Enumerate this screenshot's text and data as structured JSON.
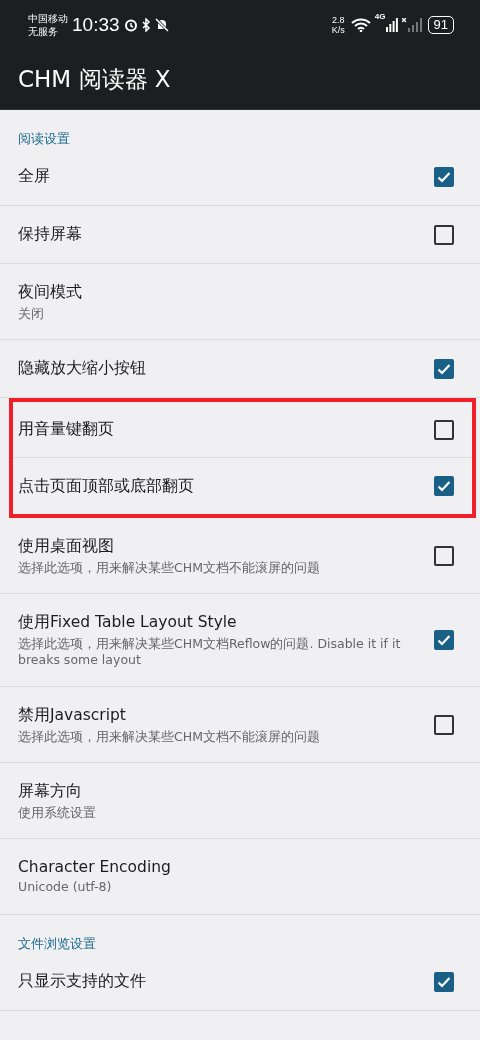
{
  "status_bar": {
    "carrier": "中国移动",
    "service": "无服务",
    "time": "10:33",
    "speed": "2.8",
    "speed_unit": "K/s",
    "network": "4G",
    "battery": "91"
  },
  "app_bar": {
    "title": "CHM 阅读器 X"
  },
  "sections": [
    {
      "title": "阅读设置",
      "items": [
        {
          "kind": "checkbox",
          "title": "全屏",
          "checked": true,
          "highlighted": false
        },
        {
          "kind": "checkbox",
          "title": "保持屏幕",
          "checked": false,
          "highlighted": false
        },
        {
          "kind": "text",
          "title": "夜间模式",
          "summary": "关闭",
          "highlighted": false
        },
        {
          "kind": "checkbox",
          "title": "隐藏放大缩小按钮",
          "checked": true,
          "highlighted": false
        },
        {
          "kind": "checkbox",
          "title": "用音量键翻页",
          "checked": false,
          "highlighted": true
        },
        {
          "kind": "checkbox",
          "title": "点击页面顶部或底部翻页",
          "checked": true,
          "highlighted": true
        },
        {
          "kind": "checkbox",
          "title": "使用桌面视图",
          "summary": "选择此选项，用来解决某些CHM文档不能滚屏的问题",
          "checked": false,
          "highlighted": false
        },
        {
          "kind": "checkbox",
          "title": "使用Fixed Table Layout Style",
          "summary": "选择此选项，用来解决某些CHM文档Reflow的问题. Disable it if it breaks some layout",
          "checked": true,
          "highlighted": false
        },
        {
          "kind": "checkbox",
          "title": "禁用Javascript",
          "summary": "选择此选项，用来解决某些CHM文档不能滚屏的问题",
          "checked": false,
          "highlighted": false
        },
        {
          "kind": "text",
          "title": "屏幕方向",
          "summary": "使用系统设置",
          "highlighted": false
        },
        {
          "kind": "text",
          "title": "Character Encoding",
          "summary": "Unicode (utf-8)",
          "highlighted": false
        }
      ]
    },
    {
      "title": "文件浏览设置",
      "items": [
        {
          "kind": "checkbox",
          "title": "只显示支持的文件",
          "checked": true,
          "highlighted": false
        }
      ]
    }
  ]
}
